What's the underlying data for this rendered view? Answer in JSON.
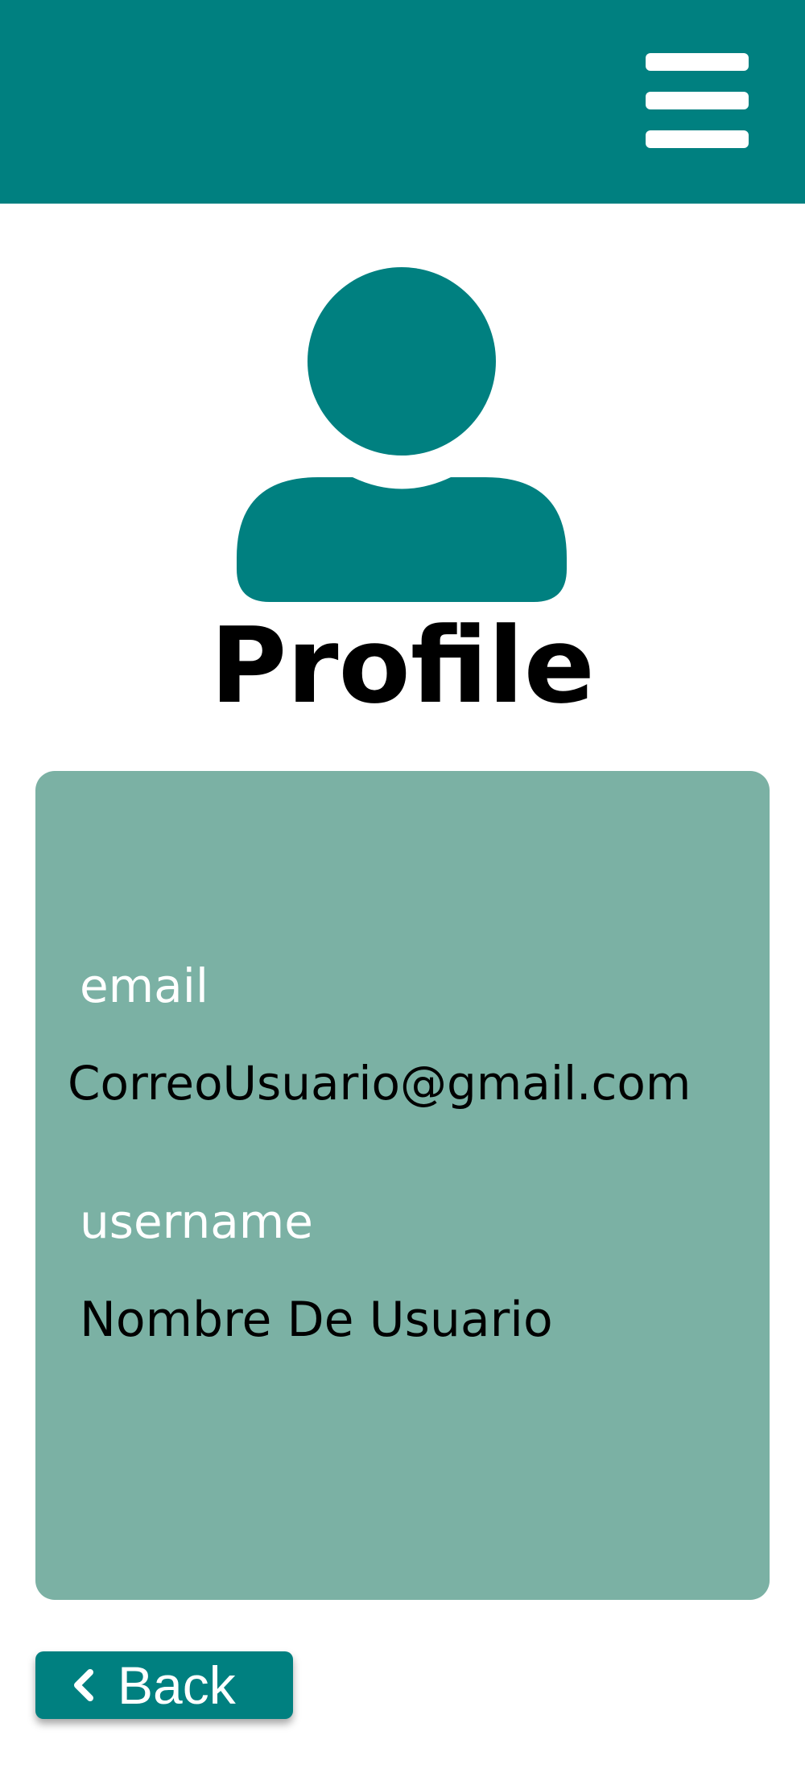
{
  "header": {
    "menu_icon": "hamburger-menu-icon"
  },
  "avatar": {
    "icon": "user-profile-icon"
  },
  "page": {
    "title": "Profile"
  },
  "profile_card": {
    "email_label": "email",
    "email_value": "CorreoUsuario@gmail.com",
    "username_label": "username",
    "username_value": "Nombre De Usuario"
  },
  "footer": {
    "back_label": "Back",
    "back_icon": "chevron-left-icon"
  },
  "colors": {
    "primary": "#008080",
    "card": "#7bb1a4",
    "text": "#000000",
    "label": "#ffffff"
  }
}
